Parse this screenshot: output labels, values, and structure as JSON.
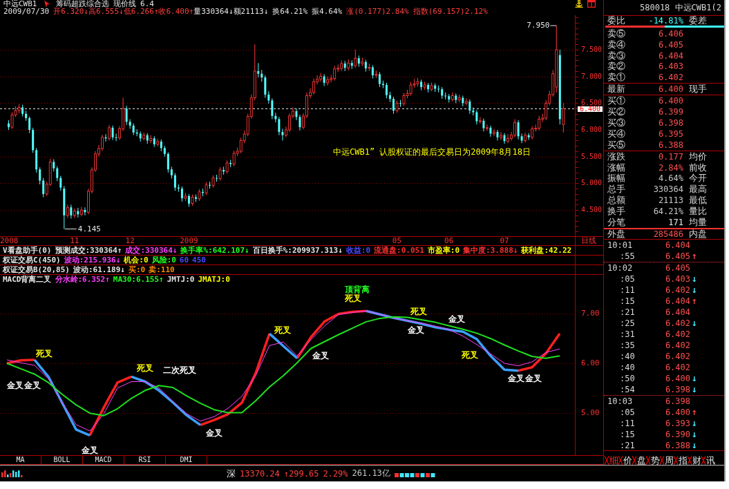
{
  "header": {
    "symbol": "中远CWB1",
    "formula": "筹码超跌综合选",
    "price_line": "现价线 6.4"
  },
  "quote_line": {
    "date": "2009/07/30",
    "items": [
      {
        "text": "开6.320↓",
        "color": "#ff4040"
      },
      {
        "text": "高6.555↓",
        "color": "#ff4040"
      },
      {
        "text": "低6.266↑",
        "color": "#ff4040"
      },
      {
        "text": "收6.400↑",
        "color": "#ff4040"
      },
      {
        "text": "量330364↓",
        "color": "#e6e6e6"
      },
      {
        "text": "额21113↓",
        "color": "#e6e6e6"
      },
      {
        "text": "换64.21%",
        "color": "#e6e6e6"
      },
      {
        "text": "振4.64%",
        "color": "#e6e6e6"
      },
      {
        "text": "涨(0.177)2.84%",
        "color": "#ff4040"
      },
      {
        "text": "指数(69.157)2.12%",
        "color": "#ff4040"
      }
    ]
  },
  "main_chart": {
    "high_label": "7.950",
    "low_label": "4.145",
    "notice": "中远CWB1” 认股权证的最后交易日为2009年8月18日",
    "period": "日线",
    "chart_data": {
      "type": "candlestick",
      "grid": true,
      "ylim": [
        3.829,
        8.145
      ],
      "yticks": [
        {
          "value": 7.5,
          "label": "7.500"
        },
        {
          "value": 7,
          "label": "7.000"
        },
        {
          "value": 6.5,
          "label": "6.500"
        },
        {
          "value": 6,
          "label": "6.000"
        },
        {
          "value": 5.5,
          "label": "5.500"
        },
        {
          "value": 5,
          "label": "5.000"
        },
        {
          "value": 4.5,
          "label": "4.500"
        }
      ],
      "ref_lines": [
        {
          "axis": "y",
          "value": 6.4,
          "label": "6.400",
          "color": "#e0e0e0"
        }
      ],
      "categories": [
        null,
        null,
        "2008",
        null,
        null,
        null,
        null,
        null,
        null,
        null,
        null,
        null,
        null,
        null,
        null,
        null,
        null,
        null,
        null,
        null,
        null,
        "11",
        null,
        null,
        null,
        null,
        null,
        null,
        null,
        null,
        null,
        null,
        null,
        null,
        null,
        null,
        null,
        "12",
        null,
        null,
        null,
        null,
        null,
        null,
        null,
        null,
        null,
        null,
        null,
        null,
        null,
        null,
        null,
        null,
        "2009",
        null,
        null,
        null,
        null,
        null,
        null,
        null,
        null,
        null,
        null,
        null,
        null,
        null,
        null,
        null,
        null,
        null,
        null,
        null,
        null,
        null,
        null,
        null,
        null,
        null,
        null,
        null,
        null,
        null,
        null,
        null,
        null,
        null,
        null,
        null,
        null,
        null,
        null,
        null,
        null,
        null,
        null,
        null,
        null,
        null,
        null,
        null,
        null,
        null,
        null,
        null,
        null,
        null,
        null,
        null,
        null,
        null,
        null,
        null,
        "05",
        null,
        null,
        null,
        null,
        null,
        null,
        null,
        null,
        null,
        null,
        null,
        null,
        null,
        null,
        "06",
        null,
        null,
        null,
        null,
        null,
        null,
        null,
        null,
        null,
        null,
        null,
        null,
        null,
        null,
        null,
        "07",
        null,
        null,
        null,
        null,
        null,
        null,
        null,
        null,
        null,
        null,
        null,
        null,
        null,
        null,
        null,
        null,
        null,
        null,
        null,
        null,
        null,
        null,
        null,
        null,
        null,
        null,
        null,
        null
      ],
      "ohlc": [
        null,
        null,
        [
          6.12,
          6.18,
          6.0,
          6.05
        ],
        [
          6.05,
          6.33,
          6.02,
          6.28
        ],
        [
          6.28,
          6.44,
          6.24,
          6.36
        ],
        [
          6.36,
          6.48,
          6.31,
          6.42
        ],
        [
          6.42,
          6.47,
          6.25,
          6.3
        ],
        [
          6.3,
          6.36,
          6.17,
          6.22
        ],
        [
          6.22,
          6.25,
          5.94,
          6.0
        ],
        [
          6.0,
          6.04,
          5.57,
          5.62
        ],
        [
          5.62,
          5.66,
          5.2,
          5.26
        ],
        [
          5.26,
          5.3,
          4.98,
          5.05
        ],
        [
          5.05,
          5.1,
          4.74,
          4.8
        ],
        [
          4.8,
          5.03,
          4.76,
          4.98
        ],
        [
          4.98,
          5.46,
          4.95,
          5.4
        ],
        [
          5.4,
          5.45,
          5.22,
          5.28
        ],
        [
          5.28,
          5.32,
          5.04,
          5.1
        ],
        [
          5.1,
          5.14,
          4.86,
          4.92
        ],
        [
          4.9,
          4.95,
          4.145,
          4.4
        ],
        [
          4.4,
          4.6,
          4.35,
          4.55
        ],
        [
          4.55,
          4.6,
          4.34,
          4.4
        ],
        [
          4.4,
          4.53,
          4.35,
          4.48
        ],
        [
          4.48,
          4.54,
          4.36,
          4.42
        ],
        [
          4.42,
          4.56,
          4.38,
          4.5
        ],
        [
          4.5,
          4.55,
          4.4,
          4.46
        ],
        [
          4.46,
          4.9,
          4.42,
          4.85
        ],
        [
          4.85,
          5.3,
          4.81,
          5.25
        ],
        [
          5.25,
          5.6,
          5.21,
          5.55
        ],
        [
          5.55,
          5.72,
          5.5,
          5.65
        ],
        [
          5.65,
          5.91,
          5.61,
          5.86
        ],
        [
          5.86,
          5.92,
          5.78,
          5.84
        ],
        [
          5.84,
          6.09,
          5.8,
          6.04
        ],
        [
          6.04,
          6.08,
          5.81,
          5.86
        ],
        [
          5.86,
          5.93,
          5.79,
          5.85
        ],
        [
          5.85,
          6.07,
          5.81,
          6.02
        ],
        [
          6.02,
          6.6,
          5.98,
          6.4
        ],
        [
          6.4,
          6.45,
          6.09,
          6.15
        ],
        [
          6.15,
          6.2,
          6.02,
          6.08
        ],
        [
          6.08,
          6.12,
          5.9,
          5.95
        ],
        [
          5.95,
          6.01,
          5.88,
          5.93
        ],
        [
          5.93,
          5.97,
          5.78,
          5.84
        ],
        [
          5.84,
          5.95,
          5.8,
          5.9
        ],
        [
          5.9,
          5.94,
          5.74,
          5.8
        ],
        [
          5.8,
          5.9,
          5.75,
          5.84
        ],
        [
          5.84,
          5.88,
          5.68,
          5.73
        ],
        [
          5.73,
          5.83,
          5.69,
          5.78
        ],
        [
          5.78,
          5.82,
          5.6,
          5.66
        ],
        [
          5.66,
          5.7,
          5.5,
          5.55
        ],
        [
          5.55,
          5.58,
          5.2,
          5.26
        ],
        [
          5.26,
          5.31,
          5.09,
          5.15
        ],
        [
          5.15,
          5.19,
          4.86,
          4.92
        ],
        [
          4.92,
          4.98,
          4.84,
          4.9
        ],
        [
          4.9,
          4.94,
          4.66,
          4.72
        ],
        [
          4.72,
          4.82,
          4.67,
          4.76
        ],
        [
          4.76,
          4.8,
          4.56,
          4.62
        ],
        [
          4.62,
          4.79,
          4.58,
          4.74
        ],
        [
          4.74,
          4.79,
          4.65,
          4.71
        ],
        [
          4.71,
          4.89,
          4.67,
          4.84
        ],
        [
          4.84,
          4.9,
          4.76,
          4.82
        ],
        [
          4.82,
          5.02,
          4.78,
          4.97
        ],
        [
          4.97,
          5.03,
          4.9,
          4.96
        ],
        [
          4.96,
          5.15,
          4.92,
          5.1
        ],
        [
          5.1,
          5.16,
          5.03,
          5.09
        ],
        [
          5.09,
          5.3,
          5.05,
          5.25
        ],
        [
          5.25,
          5.31,
          5.16,
          5.22
        ],
        [
          5.22,
          5.43,
          5.18,
          5.38
        ],
        [
          5.38,
          5.44,
          5.3,
          5.36
        ],
        [
          5.36,
          5.61,
          5.32,
          5.56
        ],
        [
          5.56,
          5.67,
          5.51,
          5.6
        ],
        [
          5.6,
          5.85,
          5.56,
          5.8
        ],
        [
          5.8,
          5.98,
          5.75,
          5.92
        ],
        [
          5.92,
          6.3,
          5.88,
          6.25
        ],
        [
          6.25,
          6.66,
          6.21,
          6.6
        ],
        [
          6.6,
          7.6,
          6.55,
          7.1
        ],
        [
          7.1,
          7.25,
          6.98,
          7.05
        ],
        [
          7.05,
          7.12,
          6.9,
          6.98
        ],
        [
          6.98,
          7.02,
          6.6,
          6.66
        ],
        [
          6.66,
          6.72,
          6.49,
          6.55
        ],
        [
          6.55,
          6.59,
          6.2,
          6.26
        ],
        [
          6.26,
          6.32,
          6.14,
          6.2
        ],
        [
          6.2,
          6.24,
          5.9,
          5.96
        ],
        [
          5.96,
          6.02,
          5.8,
          5.9
        ],
        [
          5.9,
          6.06,
          5.86,
          6.0
        ],
        [
          6.0,
          6.31,
          5.96,
          6.26
        ],
        [
          6.26,
          6.42,
          6.22,
          6.35
        ],
        [
          6.35,
          6.4,
          6.18,
          6.24
        ],
        [
          6.24,
          6.28,
          5.99,
          6.05
        ],
        [
          6.05,
          6.31,
          6.01,
          6.26
        ],
        [
          6.26,
          6.7,
          6.22,
          6.64
        ],
        [
          6.64,
          6.78,
          6.59,
          6.7
        ],
        [
          6.7,
          6.96,
          6.66,
          6.9
        ],
        [
          6.9,
          7.02,
          6.85,
          6.95
        ],
        [
          6.95,
          7.06,
          6.9,
          7.0
        ],
        [
          7.0,
          7.04,
          6.82,
          6.88
        ],
        [
          6.88,
          7.0,
          6.83,
          6.94
        ],
        [
          6.94,
          7.03,
          6.89,
          6.96
        ],
        [
          6.96,
          7.2,
          6.92,
          7.14
        ],
        [
          7.14,
          7.22,
          7.08,
          7.15
        ],
        [
          7.15,
          7.3,
          7.1,
          7.24
        ],
        [
          7.24,
          7.29,
          7.1,
          7.16
        ],
        [
          7.16,
          7.32,
          7.11,
          7.25
        ],
        [
          7.25,
          7.3,
          7.14,
          7.2
        ],
        [
          7.2,
          7.5,
          7.16,
          7.34
        ],
        [
          7.34,
          7.39,
          7.18,
          7.24
        ],
        [
          7.24,
          7.35,
          7.19,
          7.27
        ],
        [
          7.27,
          7.31,
          7.09,
          7.15
        ],
        [
          7.15,
          7.24,
          7.1,
          7.17
        ],
        [
          7.17,
          7.21,
          6.96,
          7.02
        ],
        [
          7.02,
          7.11,
          6.97,
          7.04
        ],
        [
          7.04,
          7.08,
          6.8,
          6.86
        ],
        [
          6.86,
          6.92,
          6.78,
          6.84
        ],
        [
          6.84,
          6.88,
          6.59,
          6.65
        ],
        [
          6.65,
          6.71,
          6.52,
          6.58
        ],
        [
          6.58,
          6.62,
          6.3,
          6.36
        ],
        [
          6.36,
          6.55,
          6.32,
          6.5
        ],
        [
          6.5,
          6.56,
          6.43,
          6.49
        ],
        [
          6.49,
          6.69,
          6.45,
          6.64
        ],
        [
          6.64,
          6.75,
          6.59,
          6.68
        ],
        [
          6.68,
          6.9,
          6.64,
          6.84
        ],
        [
          6.84,
          6.95,
          6.79,
          6.86
        ],
        [
          6.86,
          6.97,
          6.81,
          6.9
        ],
        [
          6.9,
          6.94,
          6.74,
          6.8
        ],
        [
          6.8,
          6.9,
          6.75,
          6.84
        ],
        [
          6.84,
          6.88,
          6.7,
          6.76
        ],
        [
          6.76,
          6.89,
          6.72,
          6.83
        ],
        [
          6.83,
          6.87,
          6.71,
          6.77
        ],
        [
          6.77,
          6.83,
          6.7,
          6.76
        ],
        [
          6.76,
          6.8,
          6.58,
          6.64
        ],
        [
          6.64,
          6.7,
          6.57,
          6.63
        ],
        [
          6.63,
          6.67,
          6.51,
          6.57
        ],
        [
          6.57,
          6.7,
          6.53,
          6.64
        ],
        [
          6.64,
          6.68,
          6.5,
          6.56
        ],
        [
          6.56,
          6.66,
          6.52,
          6.6
        ],
        [
          6.6,
          6.64,
          6.44,
          6.5
        ],
        [
          6.5,
          6.59,
          6.46,
          6.53
        ],
        [
          6.53,
          6.57,
          6.3,
          6.36
        ],
        [
          6.36,
          6.42,
          6.27,
          6.33
        ],
        [
          6.33,
          6.37,
          6.1,
          6.16
        ],
        [
          6.16,
          6.24,
          6.11,
          6.17
        ],
        [
          6.17,
          6.21,
          5.97,
          6.03
        ],
        [
          6.03,
          6.1,
          5.98,
          6.04
        ],
        [
          6.04,
          6.08,
          5.87,
          5.93
        ],
        [
          5.93,
          6.02,
          5.88,
          5.96
        ],
        [
          5.96,
          6.0,
          5.8,
          5.86
        ],
        [
          5.86,
          5.96,
          5.81,
          5.9
        ],
        [
          5.9,
          5.94,
          5.74,
          5.79
        ],
        [
          5.79,
          5.92,
          5.75,
          5.84
        ],
        [
          5.84,
          5.96,
          5.8,
          5.9
        ],
        [
          5.9,
          6.2,
          5.86,
          6.14
        ],
        [
          6.14,
          6.18,
          5.82,
          5.88
        ],
        [
          5.88,
          5.93,
          5.75,
          5.8
        ],
        [
          5.8,
          5.95,
          5.76,
          5.9
        ],
        [
          5.9,
          5.94,
          5.81,
          5.86
        ],
        [
          5.86,
          6.07,
          5.82,
          6.02
        ],
        [
          6.02,
          6.1,
          5.97,
          6.03
        ],
        [
          6.03,
          6.26,
          5.99,
          6.2
        ],
        [
          6.2,
          6.3,
          6.15,
          6.22
        ],
        [
          6.22,
          6.56,
          6.18,
          6.5
        ],
        [
          6.5,
          6.73,
          6.46,
          6.66
        ],
        [
          6.66,
          7.12,
          6.62,
          7.05
        ],
        [
          6.8,
          7.95,
          6.7,
          7.5
        ],
        [
          7.4,
          7.5,
          6.1,
          6.2
        ],
        [
          6.1,
          6.5,
          5.95,
          6.4
        ],
        null,
        null,
        null,
        null,
        null,
        null,
        null,
        null,
        null,
        null,
        null
      ]
    }
  },
  "indicator_rows": [
    {
      "segments": [
        {
          "text": "V看盘助手(0)",
          "color": "#e6e6e6"
        },
        {
          "text": "预测成交:330364↑",
          "color": "#e6e6e6"
        },
        {
          "text": "成交:330364↓",
          "color": "#ff40ff"
        },
        {
          "text": "换手率%:642.107↓",
          "color": "#20ff20"
        },
        {
          "text": "百日换手%:209937.313↓",
          "color": "#e6e6e6"
        },
        {
          "text": "收益:0",
          "color": "#4848ff"
        },
        {
          "text": "流通盘:0.051",
          "color": "#ff3030"
        },
        {
          "text": "市盈率:0",
          "color": "#ffff00"
        },
        {
          "text": "集中度:3.888↓",
          "color": "#ff3030"
        },
        {
          "text": "获利盘:42.22",
          "color": "#ffff00"
        }
      ]
    },
    {
      "segments": [
        {
          "text": "权证交易C(450)",
          "color": "#e6e6e6"
        },
        {
          "text": "波动:215.936↓",
          "color": "#ff40ff"
        },
        {
          "text": "机会:0",
          "color": "#ffff00"
        },
        {
          "text": "风险:0",
          "color": "#20ff20"
        },
        {
          "text": "60",
          "color": "#4848ff"
        },
        {
          "text": "450",
          "color": "#4848ff"
        }
      ]
    },
    {
      "segments": [
        {
          "text": "权证交易B(20,85)",
          "color": "#e6e6e6"
        },
        {
          "text": "波动:61.189↓",
          "color": "#e6e6e6"
        },
        {
          "text": "买:0",
          "color": "#ff8c00"
        },
        {
          "text": "卖:110",
          "color": "#ff8c00"
        }
      ]
    }
  ],
  "osc_chart": {
    "title_segments": [
      {
        "text": "MACD背离二叉",
        "color": "#e6e6e6"
      },
      {
        "text": "分水岭:6.352↑",
        "color": "#ff40ff"
      },
      {
        "text": "MA30:6.155↑",
        "color": "#20ff20"
      },
      {
        "text": "JMTJ:0",
        "color": "#e6e6e6"
      },
      {
        "text": "JMATJ:0",
        "color": "#ffff00"
      }
    ],
    "chart_data": {
      "type": "line",
      "grid": true,
      "ylim": [
        4.126,
        7.79
      ],
      "yticks": [
        {
          "value": 7,
          "label": "7.00"
        },
        {
          "value": 6,
          "label": "6.00"
        },
        {
          "value": 5,
          "label": "5.00"
        }
      ],
      "series": [
        {
          "color": "#ff2020",
          "values": [
            6.0,
            6.06,
            6.07,
            null,
            null,
            null,
            4.54,
            5.1,
            5.61,
            5.73,
            null,
            null,
            null,
            null,
            4.75,
            4.85,
            4.97,
            5.2,
            5.8,
            6.6,
            null,
            6.1,
            6.53,
            6.85,
            7.0,
            7.04,
            7.06,
            null,
            null,
            null,
            null,
            null,
            null,
            null,
            null,
            null,
            null,
            5.85,
            5.92,
            6.2,
            6.6
          ]
        },
        {
          "color": "#3aa0ff",
          "values": [
            null,
            null,
            6.07,
            5.73,
            5.2,
            4.66,
            4.54,
            null,
            null,
            5.73,
            5.63,
            5.45,
            5.21,
            4.95,
            4.75,
            null,
            null,
            null,
            null,
            6.6,
            6.35,
            6.1,
            null,
            null,
            null,
            null,
            7.06,
            6.99,
            6.92,
            6.86,
            6.8,
            6.73,
            6.68,
            6.64,
            6.49,
            6.15,
            5.87,
            5.85,
            null,
            null,
            null
          ]
        },
        {
          "color": "#ff40ff",
          "values": [
            6.07,
            6.01,
            5.96,
            5.69,
            5.21,
            4.76,
            4.63,
            4.97,
            5.5,
            5.63,
            5.63,
            5.5,
            5.23,
            4.98,
            4.83,
            4.92,
            5.09,
            5.33,
            5.75,
            6.36,
            6.43,
            6.15,
            6.48,
            6.76,
            6.99,
            7.03,
            7.06,
            6.99,
            6.92,
            6.86,
            6.81,
            6.75,
            6.68,
            6.55,
            6.38,
            6.19,
            6.0,
            5.95,
            6.03,
            6.22,
            6.29
          ]
        },
        {
          "color": "#20e020",
          "values": [
            6.0,
            5.89,
            5.78,
            5.61,
            5.37,
            5.16,
            4.99,
            4.94,
            5.08,
            5.29,
            5.45,
            5.55,
            5.51,
            5.34,
            5.19,
            5.06,
            5.0,
            5.0,
            5.24,
            5.52,
            5.75,
            6.01,
            6.3,
            6.44,
            6.58,
            6.71,
            6.84,
            6.91,
            6.94,
            6.93,
            6.88,
            6.83,
            6.76,
            6.69,
            6.61,
            6.5,
            6.37,
            6.25,
            6.14,
            6.1,
            6.15
          ]
        }
      ]
    },
    "signals": [
      {
        "text": "金叉",
        "color": "#ffffff"
      },
      {
        "text": "金叉",
        "color": "#ffffff"
      },
      {
        "text": "死叉",
        "color": "#ffff00"
      },
      {
        "text": "金叉",
        "color": "#ffffff"
      },
      {
        "text": "死叉",
        "color": "#ffff00"
      },
      {
        "text": "二次死叉",
        "color": "#ffffff"
      },
      {
        "text": "金叉",
        "color": "#ffffff"
      },
      {
        "text": "死叉",
        "color": "#ffff00"
      },
      {
        "text": "金叉",
        "color": "#ffffff"
      },
      {
        "text": "顶背离",
        "color": "#20ff20"
      },
      {
        "text": "死叉",
        "color": "#ffff00"
      },
      {
        "text": "死叉",
        "color": "#ffff00"
      },
      {
        "text": "金叉",
        "color": "#ffffff"
      },
      {
        "text": "金叉",
        "color": "#ffffff"
      },
      {
        "text": "死叉",
        "color": "#ffff00"
      },
      {
        "text": "金叉",
        "color": "#ffffff"
      },
      {
        "text": "金叉",
        "color": "#ffffff"
      }
    ]
  },
  "indicator_tabs": [
    {
      "label": "MA",
      "selected": false
    },
    {
      "label": "BOLL",
      "selected": false
    },
    {
      "label": "MACD",
      "selected": false
    },
    {
      "label": "RSI",
      "selected": false
    },
    {
      "label": "DMI",
      "selected": false
    }
  ],
  "quote_panel": {
    "title": "580018 中远CWB1(2",
    "ratio": {
      "label": "委比",
      "value": "-14.81%",
      "label2": "委差",
      "level": 0.5
    },
    "asks": [
      {
        "label": "卖⑤",
        "price": "6.406"
      },
      {
        "label": "卖④",
        "price": "6.405"
      },
      {
        "label": "卖③",
        "price": "6.404"
      },
      {
        "label": "卖②",
        "price": "6.403"
      },
      {
        "label": "卖①",
        "price": "6.402"
      }
    ],
    "last": {
      "label": "最新",
      "price": "6.400",
      "label2": "现手"
    },
    "bids": [
      {
        "label": "买①",
        "price": "6.400"
      },
      {
        "label": "买②",
        "price": "6.399"
      },
      {
        "label": "买③",
        "price": "6.398"
      },
      {
        "label": "买④",
        "price": "6.395"
      },
      {
        "label": "买⑤",
        "price": "6.388"
      }
    ],
    "stats": [
      {
        "label": "涨跌",
        "value": "0.177",
        "label2": "均价",
        "color": "#ff5050"
      },
      {
        "label": "涨幅",
        "value": "2.84%",
        "label2": "前收",
        "color": "#ff5050"
      },
      {
        "label": "振幅",
        "value": "4.64%",
        "label2": "今开",
        "color": "#c8c8c8"
      },
      {
        "label": "总手",
        "value": "330364",
        "label2": "最高",
        "color": "#c8c8c8"
      },
      {
        "label": "总额",
        "value": "21113",
        "label2": "最低",
        "color": "#c8c8c8"
      },
      {
        "label": "换手",
        "value": "64.21%",
        "label2": "量比",
        "color": "#c8c8c8"
      },
      {
        "label": "分笔",
        "value": "171",
        "label2": "均量",
        "color": "#ececec"
      }
    ],
    "outer": {
      "label": "外盘",
      "value": "285486",
      "label2": "内盘"
    }
  },
  "tick_groups": [
    {
      "ticks": [
        {
          "time": "10:01",
          "price": "6.404"
        },
        {
          "time": ":55",
          "price": "6.405",
          "arrow": "↑",
          "color": "#ff4040"
        }
      ]
    },
    {
      "ticks": [
        {
          "time": "10:02",
          "price": "6.405"
        },
        {
          "time": ":05",
          "price": "6.403",
          "arrow": "↓",
          "color": "#40e8ff"
        },
        {
          "time": ":11",
          "price": "6.402",
          "arrow": "↓",
          "color": "#40e8ff"
        },
        {
          "time": ":15",
          "price": "6.404",
          "arrow": "↑",
          "color": "#ff4040"
        },
        {
          "time": ":21",
          "price": "6.404"
        },
        {
          "time": ":25",
          "price": "6.402",
          "arrow": "↓",
          "color": "#40e8ff"
        },
        {
          "time": ":31",
          "price": "6.402"
        },
        {
          "time": ":35",
          "price": "6.402"
        },
        {
          "time": ":40",
          "price": "6.402"
        },
        {
          "time": ":40",
          "price": "6.402"
        },
        {
          "time": ":50",
          "price": "6.400",
          "arrow": "↓",
          "color": "#40e8ff"
        },
        {
          "time": ":54",
          "price": "6.398",
          "arrow": "↓",
          "color": "#40e8ff"
        }
      ]
    },
    {
      "ticks": [
        {
          "time": "10:03",
          "price": "6.398"
        },
        {
          "time": ":05",
          "price": "6.400",
          "arrow": "↑",
          "color": "#ff4040"
        },
        {
          "time": ":11",
          "price": "6.393",
          "arrow": "↓",
          "color": "#40e8ff"
        },
        {
          "time": ":15",
          "price": "6.390",
          "arrow": "↓",
          "color": "#40e8ff"
        },
        {
          "time": ":21",
          "price": "6.388",
          "arrow": "↓",
          "color": "#40e8ff"
        }
      ]
    }
  ],
  "panel_tabs": [
    {
      "label": "细",
      "selected": true
    },
    {
      "label": "价",
      "selected": false
    },
    {
      "label": "盘",
      "selected": false
    },
    {
      "label": "势",
      "selected": false
    },
    {
      "label": "周",
      "selected": false
    },
    {
      "label": "指",
      "selected": false
    },
    {
      "label": "财",
      "selected": false
    },
    {
      "label": "讯",
      "selected": false
    }
  ],
  "status_bar": {
    "market": "深",
    "items": [
      {
        "text": "13370.24",
        "color": "#ff4040"
      },
      {
        "text": "↑299.65",
        "color": "#ff4040"
      },
      {
        "text": "2.29%",
        "color": "#ff4040"
      },
      {
        "text": "261.13亿",
        "color": "#c8c8c8"
      }
    ]
  }
}
